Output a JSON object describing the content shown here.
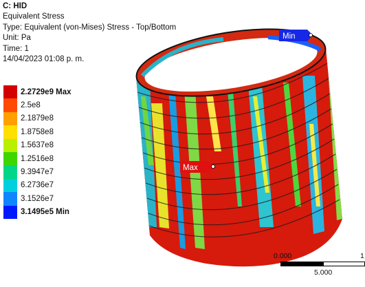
{
  "header": {
    "title": "C: HID",
    "line1": "Equivalent Stress",
    "line2": "Type: Equivalent (von-Mises) Stress - Top/Bottom",
    "line3": "Unit: Pa",
    "line4": "Time: 1",
    "line5": "14/04/2023 01:08 p. m."
  },
  "legend": {
    "items": [
      {
        "label": "2.2729e9 Max",
        "color": "#d40000"
      },
      {
        "label": "2.5e8",
        "color": "#ff4a00"
      },
      {
        "label": "2.1879e8",
        "color": "#ff9f00"
      },
      {
        "label": "1.8758e8",
        "color": "#ffe000"
      },
      {
        "label": "1.5637e8",
        "color": "#b8f000"
      },
      {
        "label": "1.2516e8",
        "color": "#3ed600"
      },
      {
        "label": "9.3947e7",
        "color": "#00d687"
      },
      {
        "label": "6.2736e7",
        "color": "#00cfe0"
      },
      {
        "label": "3.1526e7",
        "color": "#0f86ff"
      },
      {
        "label": "3.1495e5 Min",
        "color": "#0018ff"
      }
    ]
  },
  "probes": {
    "max_label": "Max",
    "min_label": "Min"
  },
  "scale": {
    "tick_start": "0.000",
    "tick_end": "1",
    "tick_mid": "5.000"
  }
}
